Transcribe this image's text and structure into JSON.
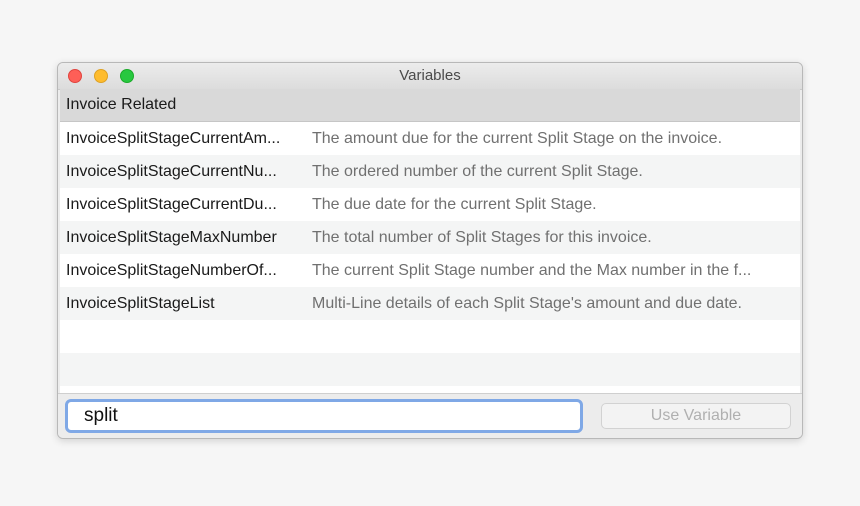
{
  "window": {
    "title": "Variables"
  },
  "list": {
    "group_header": "Invoice Related",
    "rows": [
      {
        "name": "InvoiceSplitStageCurrentAm...",
        "description": "The amount due for the current Split Stage on the invoice."
      },
      {
        "name": "InvoiceSplitStageCurrentNu...",
        "description": "The ordered number of the current Split Stage."
      },
      {
        "name": "InvoiceSplitStageCurrentDu...",
        "description": "The due date for the current Split Stage."
      },
      {
        "name": "InvoiceSplitStageMaxNumber",
        "description": "The total number of Split Stages for this invoice."
      },
      {
        "name": "InvoiceSplitStageNumberOf...",
        "description": "The current Split Stage number and the Max number in the f..."
      },
      {
        "name": "InvoiceSplitStageList",
        "description": "Multi-Line details of each Split Stage's amount and due date."
      }
    ]
  },
  "bottom": {
    "search_value": "split",
    "use_button_label": "Use Variable"
  }
}
